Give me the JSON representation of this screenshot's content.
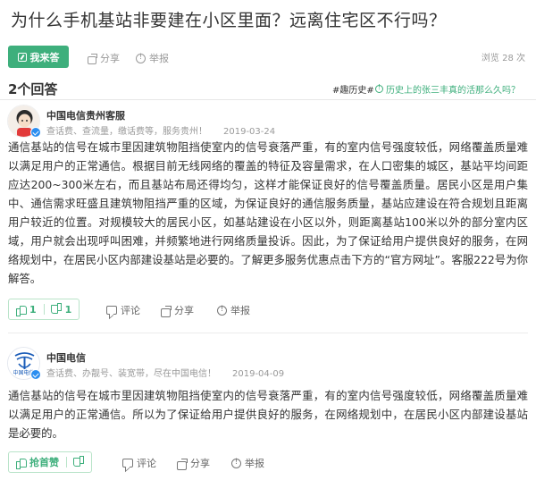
{
  "question": {
    "title": "为什么手机基站非要建在小区里面？远离住宅区不行吗？",
    "answer_button": "我来答",
    "share_label": "分享",
    "report_label": "举报",
    "views_label": "浏览 28 次"
  },
  "answers_header": {
    "count_label": "2个回答",
    "side_tag": "#趣历史#",
    "side_link": "历史上的张三丰真的活那么久吗？"
  },
  "answers": [
    {
      "author_name": "中国电信贵州客服",
      "author_desc": "查话费、查流量，缴话费等，服务贵州！",
      "date": "2019-03-24",
      "body": "通信基站的信号在城市里因建筑物阻挡使室内的信号衰落严重，有的室内信号强度较低，网络覆盖质量难以满足用户的正常通信。根据目前无线网络的覆盖的特征及容量需求，在人口密集的城区，基站平均间距应达200~300米左右，而且基站布局还得均匀，这样才能保证良好的信号覆盖质量。居民小区是用户集中、通信需求旺盛且建筑物阻挡严重的区域，为保证良好的通信服务质量，基站应建设在符合规划且距离用户较近的位置。对规模较大的居民小区，如基站建设在小区以外，则距离基站100米以外的部分室内区域，用户就会出现呼叫困难，并频繁地进行网络质量投诉。因此，为了保证给用户提供良好的服务，在网络规划中，在居民小区内部建设基站是必要的。了解更多服务优惠点击下方的“官方网址”。客服222号为你解答。",
      "upvotes": "1",
      "downvotes": "1",
      "comment_label": "评论",
      "share_label": "分享",
      "report_label": "举报"
    },
    {
      "author_name": "中国电信",
      "author_desc": "查话费、办靓号、装宽带，尽在中国电信！",
      "date": "2019-04-09",
      "body": "通信基站的信号在城市里因建筑物阻挡使室内的信号衰落严重，有的室内信号强度较低，网络覆盖质量难以满足用户的正常通信。所以为了保证给用户提供良好的服务，在网络规划中，在居民小区内部建设基站是必要的。",
      "first_vote_label": "抢首赞",
      "comment_label": "评论",
      "share_label": "分享",
      "report_label": "举报",
      "logo_text": "中国电信"
    }
  ],
  "colors": {
    "accent": "#3eaf7c",
    "verified": "#2b8ef0",
    "telecom_blue": "#1a5cb8"
  },
  "icons": [
    "pen-icon",
    "share-icon",
    "report-icon",
    "thumb-up-icon",
    "thumb-down-icon",
    "comment-icon",
    "verified-icon",
    "info-icon"
  ]
}
